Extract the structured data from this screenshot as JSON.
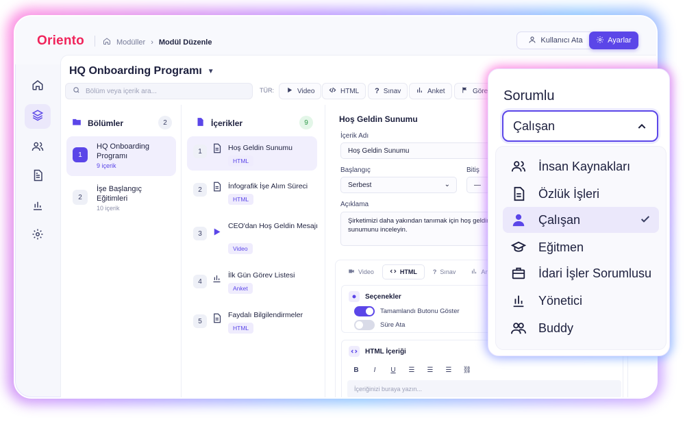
{
  "app": {
    "logo": "Oriento"
  },
  "breadcrumb": {
    "items": [
      "Modüller",
      "Modül Düzenle"
    ]
  },
  "header": {
    "assign_label": "Kullanıcı Ata",
    "settings_label": "Ayarlar"
  },
  "rail": {
    "items": [
      "home-icon",
      "layers-icon",
      "users-icon",
      "document-icon",
      "chart-icon",
      "gear-icon"
    ],
    "active_index": 1
  },
  "program": {
    "title": "HQ Onboarding Programı"
  },
  "search": {
    "placeholder": "Bölüm veya içerik ara..."
  },
  "types": {
    "label": "TÜR:",
    "items": [
      "Video",
      "HTML",
      "Sınav",
      "Anket",
      "Görev"
    ]
  },
  "sections": {
    "title": "Bölümler",
    "count": "2",
    "items": [
      {
        "num": "1",
        "name": "HQ Onboarding Programı",
        "sub": "9 içerik"
      },
      {
        "num": "2",
        "name": "İşe Başlangıç Eğitimleri",
        "sub": "10 içerik"
      }
    ]
  },
  "contents": {
    "title": "İçerikler",
    "count": "9",
    "items": [
      {
        "num": "1",
        "icon": "document-icon",
        "title": "Hoş Geldin Sunumu",
        "tag": "HTML"
      },
      {
        "num": "2",
        "icon": "document-icon",
        "title": "İnfografik İşe Alım Süreci",
        "tag": "HTML"
      },
      {
        "num": "3",
        "icon": "play-icon",
        "title": "CEO'dan Hoş Geldin Mesajı",
        "tag": "Video"
      },
      {
        "num": "4",
        "icon": "chart-icon",
        "title": "İlk Gün Görev Listesi",
        "tag": "Anket"
      },
      {
        "num": "5",
        "icon": "document-icon",
        "title": "Faydalı Bilgilendirmeler",
        "tag": "HTML"
      }
    ]
  },
  "detail": {
    "title": "Hoş Geldin Sunumu",
    "name_label": "İçerik Adı",
    "name_value": "Hoş Geldin Sunumu",
    "start_label": "Başlangıç",
    "start_value": "Serbest",
    "end_label": "Bitiş",
    "end_value": "—",
    "desc_label": "Açıklama",
    "desc_value": "Şirketimizi daha yakından tanımak için hoş geldin sunumunu inceleyin.",
    "tabs": [
      "Video",
      "HTML",
      "Sınav",
      "Anket"
    ],
    "active_tab": "HTML",
    "options_title": "Seçenekler",
    "toggle_complete": {
      "label": "Tamamlandı Butonu Göster",
      "on": true
    },
    "toggle_time": {
      "label": "Süre Ata",
      "on": false
    },
    "html_title": "HTML İçeriği",
    "format": [
      "B",
      "I",
      "U"
    ],
    "editor_placeholder": "İçeriğinizi buraya yazın..."
  },
  "dropdown": {
    "title": "Sorumlu",
    "selected": "Çalışan",
    "options": [
      {
        "label": "İnsan Kaynakları",
        "icon": "users-icon"
      },
      {
        "label": "Özlük İşleri",
        "icon": "document-icon"
      },
      {
        "label": "Çalışan",
        "icon": "user-icon",
        "selected": true
      },
      {
        "label": "Eğitmen",
        "icon": "graduation-cap-icon"
      },
      {
        "label": "İdari İşler Sorumlusu",
        "icon": "briefcase-icon"
      },
      {
        "label": "Yönetici",
        "icon": "chart-icon"
      },
      {
        "label": "Buddy",
        "icon": "users-icon"
      }
    ]
  },
  "colors": {
    "accent": "#5b46e8",
    "brand": "#f0245b",
    "accent_soft": "#ebe8fb"
  }
}
